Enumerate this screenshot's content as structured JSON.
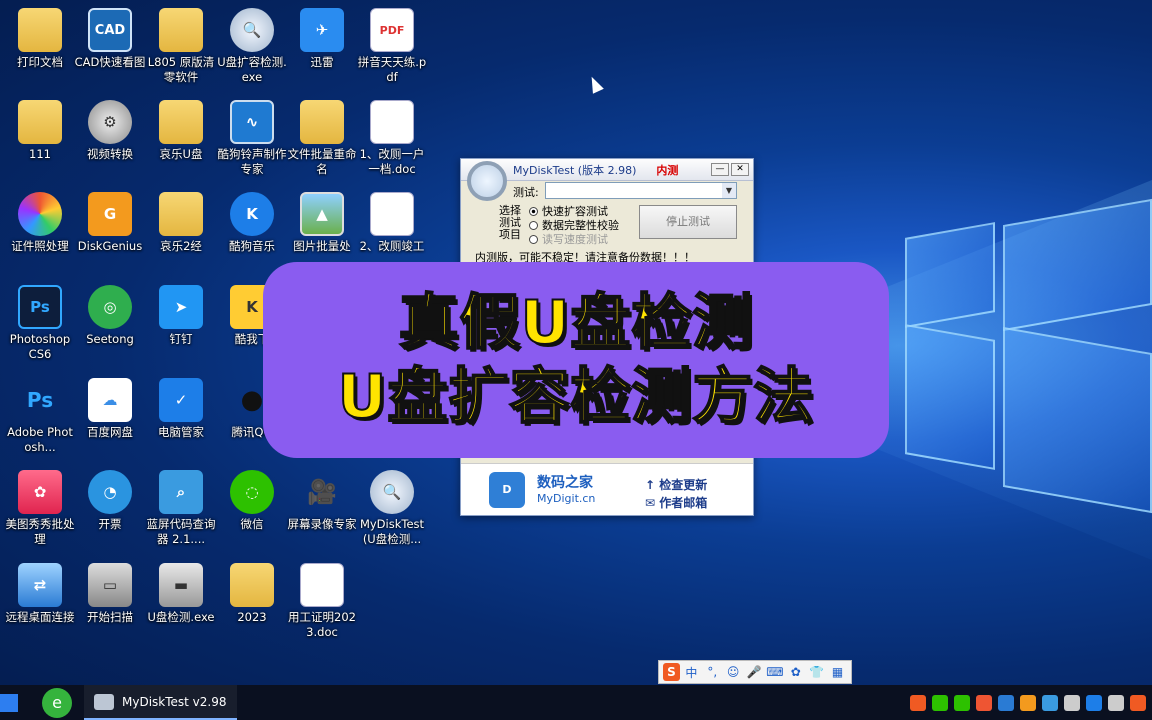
{
  "desktop": {
    "icons": [
      {
        "label": "打印文档",
        "icon": "folder-icon"
      },
      {
        "label": "CAD快速看图",
        "icon": "cad-icon"
      },
      {
        "label": "L805 原版清零软件",
        "icon": "folder-icon"
      },
      {
        "label": "U盘扩容检测.exe",
        "icon": "magnifier-icon"
      },
      {
        "label": "迅雷",
        "icon": "bird-icon"
      },
      {
        "label": "拼音天天练.pdf",
        "icon": "pdf-icon"
      },
      {
        "label": "111",
        "icon": "folder-icon"
      },
      {
        "label": "视频转换",
        "icon": "gear-icon"
      },
      {
        "label": "哀乐U盘",
        "icon": "folder-icon"
      },
      {
        "label": "酷狗铃声制作专家",
        "icon": "wave-icon"
      },
      {
        "label": "文件批量重命名",
        "icon": "folder-icon"
      },
      {
        "label": "1、改厕一户一档.doc",
        "icon": "word-icon"
      },
      {
        "label": "证件照处理",
        "icon": "aperture-icon"
      },
      {
        "label": "DiskGenius",
        "icon": "diskgenius-icon"
      },
      {
        "label": "哀乐2经",
        "icon": "folder-icon"
      },
      {
        "label": "酷狗音乐",
        "icon": "kugou-icon"
      },
      {
        "label": "图片批量处",
        "icon": "picture-icon"
      },
      {
        "label": "2、改厕竣工",
        "icon": "word-icon"
      },
      {
        "label": "Photoshop CS6",
        "icon": "photoshop-icon"
      },
      {
        "label": "Seetong",
        "icon": "seetong-icon"
      },
      {
        "label": "钉钉",
        "icon": "dingtalk-icon"
      },
      {
        "label": "酷我下",
        "icon": "kuwo-icon"
      },
      {
        "label": "Adobe Photosh...",
        "icon": "photoshop-icon"
      },
      {
        "label": "百度网盘",
        "icon": "cloud-icon"
      },
      {
        "label": "电脑管家",
        "icon": "shield-icon"
      },
      {
        "label": "腾讯QQ",
        "icon": "qq-icon"
      },
      {
        "label": "美图秀秀批处理",
        "icon": "meitu-icon"
      },
      {
        "label": "开票",
        "icon": "invoice-icon"
      },
      {
        "label": "蓝屏代码查询器 2.1....",
        "icon": "search-icon"
      },
      {
        "label": "微信",
        "icon": "wechat-icon"
      },
      {
        "label": "屏幕录像专家",
        "icon": "recorder-icon"
      },
      {
        "label": "MyDiskTest (U盘检测...",
        "icon": "magnifier-icon"
      },
      {
        "label": "远程桌面连接",
        "icon": "remote-desktop-icon"
      },
      {
        "label": "开始扫描",
        "icon": "scanner-icon"
      },
      {
        "label": "U盘检测.exe",
        "icon": "usb-icon"
      },
      {
        "label": "2023",
        "icon": "folder-icon"
      },
      {
        "label": "用工证明2023.doc",
        "icon": "word-icon"
      }
    ]
  },
  "dialog": {
    "title": "MyDiskTest (版本 2.98)",
    "edition": "内测",
    "minimize": "—",
    "close": "✕",
    "test_label": "测试:",
    "group_label": "选择测试项目",
    "options": [
      "快速扩容测试",
      "数据完整性校验",
      "读写速度测试"
    ],
    "stop_button": "停止测试",
    "warning": "内测版，可能不稳定！请注意备份数据！！！",
    "brand_name": "数码之家",
    "brand_site": "MyDigit.cn",
    "check_update": "检查更新",
    "author_mail": "作者邮箱"
  },
  "banner": {
    "line1": "真假U盘检测",
    "line2": "U盘扩容检测方法"
  },
  "ime": {
    "logo": "S",
    "items": [
      "中",
      "°,",
      "☺",
      "🎤",
      "⌨",
      "✿",
      "👕",
      "▦"
    ]
  },
  "taskbar": {
    "active_window": "MyDiskTest v2.98"
  },
  "colors": {
    "banner_bg": "#8a5cf0",
    "banner_text": "#ffe400",
    "dialog_red": "#d80000"
  }
}
